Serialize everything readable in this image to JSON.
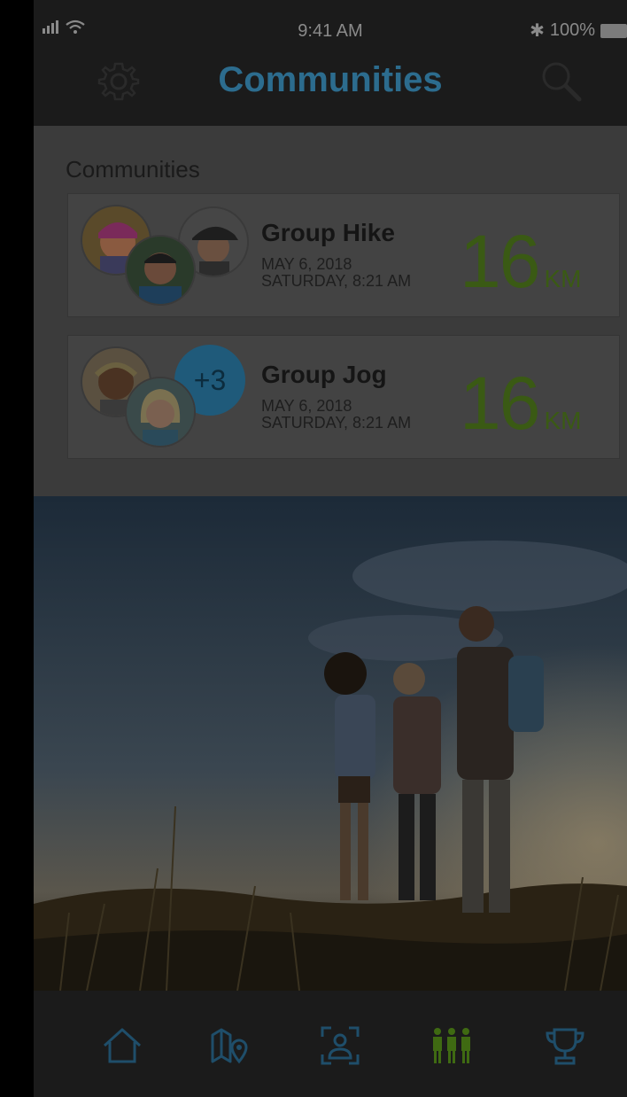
{
  "status_bar": {
    "time": "9:41 AM",
    "battery": "100%",
    "bluetooth": "✱"
  },
  "header": {
    "title": "Communities",
    "settings_icon": "gear-icon",
    "search_icon": "search-icon"
  },
  "section": {
    "title": "Communities"
  },
  "communities": [
    {
      "name": "Group Hike",
      "date": "MAY 6, 2018",
      "time": "SATURDAY, 8:21 AM",
      "distance": "16",
      "unit": "KM"
    },
    {
      "name": "Group Jog",
      "date": "MAY 6, 2018",
      "time": "SATURDAY, 8:21 AM",
      "distance": "16",
      "unit": "KM",
      "extra_members": "+3"
    }
  ],
  "tabs": [
    {
      "name": "home",
      "icon": "home-icon"
    },
    {
      "name": "map",
      "icon": "map-icon"
    },
    {
      "name": "profile",
      "icon": "person-scan-icon"
    },
    {
      "name": "communities",
      "icon": "group-icon",
      "active": true
    },
    {
      "name": "trophies",
      "icon": "trophy-icon"
    }
  ],
  "colors": {
    "accent": "#2c6c8e",
    "green": "#3a5a14",
    "tab_inactive": "#1f4e6a",
    "tab_active": "#3f6a12"
  }
}
